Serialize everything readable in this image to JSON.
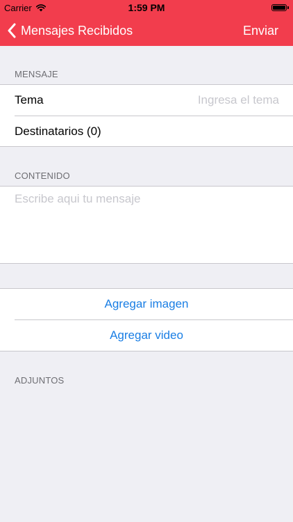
{
  "status_bar": {
    "carrier": "Carrier",
    "time": "1:59 PM",
    "battery_level": 1.0
  },
  "nav": {
    "back_label": "Mensajes Recibidos",
    "send_label": "Enviar"
  },
  "colors": {
    "nav_background": "#f23d4d",
    "page_background": "#efeff4",
    "action_text": "#1a7ee4",
    "placeholder_text": "#c7c7cd",
    "section_header_text": "#6d6d72"
  },
  "message_section": {
    "header": "MENSAJE",
    "subject_label": "Tema",
    "subject_value": "",
    "subject_placeholder": "Ingresa el tema",
    "recipients_label": "Destinatarios (0)"
  },
  "content_section": {
    "header": "CONTENIDO",
    "body_value": "",
    "body_placeholder": "Escribe aqui tu mensaje"
  },
  "actions": {
    "add_image_label": "Agregar imagen",
    "add_video_label": "Agregar video"
  },
  "attachments_section": {
    "header": "ADJUNTOS"
  },
  "icons": {
    "back": "chevron-left-icon",
    "wifi": "wifi-icon",
    "battery": "battery-icon"
  }
}
